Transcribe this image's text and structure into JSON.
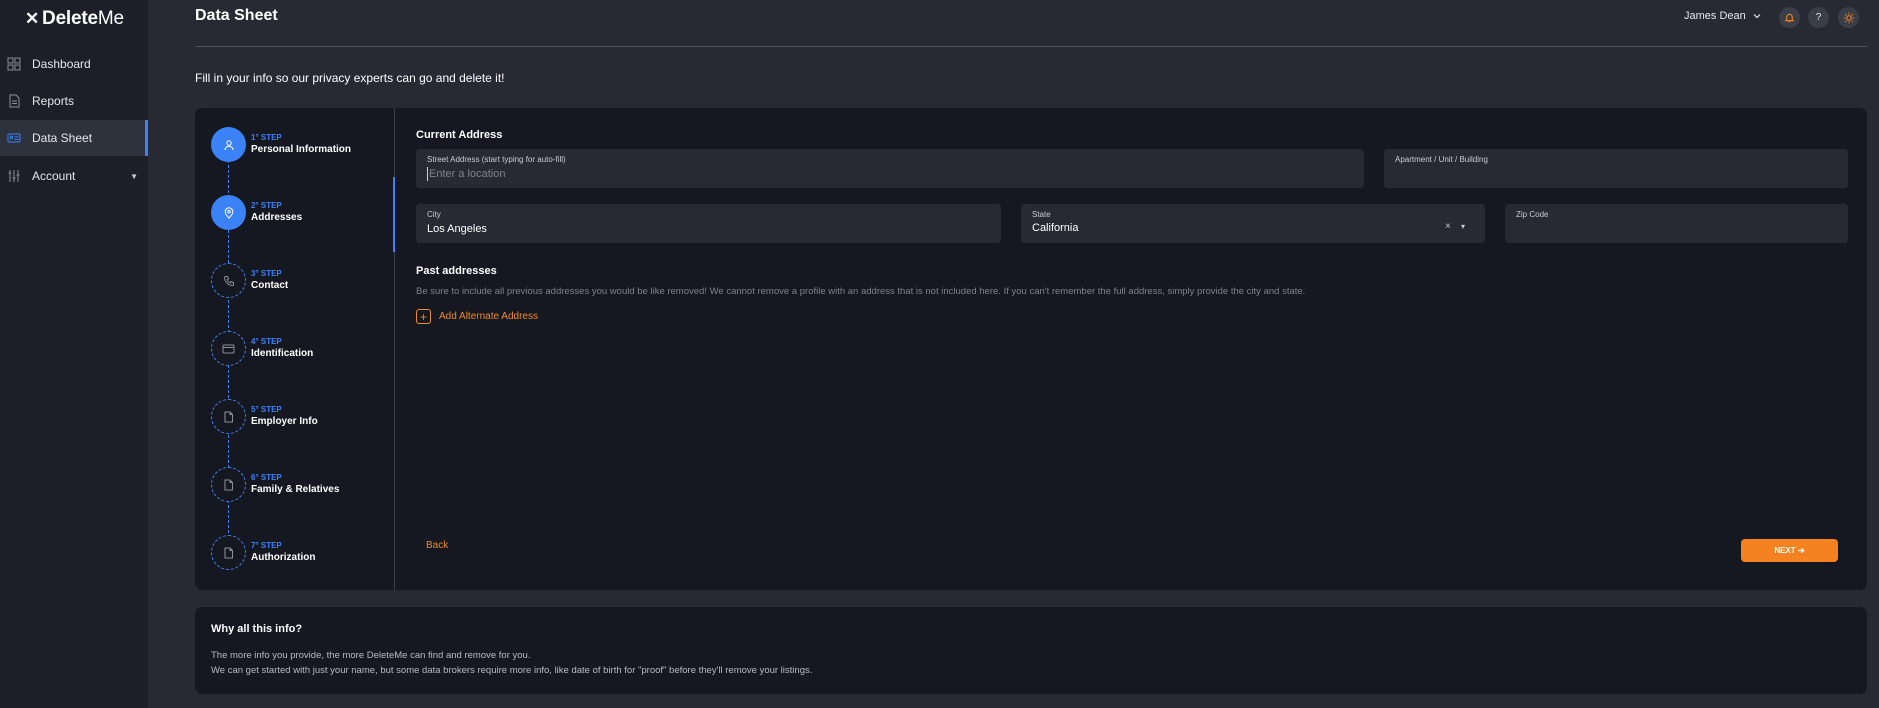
{
  "app": {
    "logo_mark": "✕",
    "logo_bold": "Delete",
    "logo_light": "Me"
  },
  "sidebar": {
    "items": [
      {
        "label": "Dashboard",
        "icon": "grid-icon"
      },
      {
        "label": "Reports",
        "icon": "document-icon"
      },
      {
        "label": "Data Sheet",
        "icon": "id-card-icon",
        "active": true
      },
      {
        "label": "Account",
        "icon": "sliders-icon",
        "has_caret": true
      }
    ]
  },
  "header": {
    "title": "Data Sheet",
    "user_name": "James Dean",
    "bell_icon": "bell-icon",
    "help_label": "?",
    "theme_icon": "sun-icon"
  },
  "intro": "Fill in your info so our privacy experts can go and delete it!",
  "steps": [
    {
      "num": "1° STEP",
      "title": "Personal Information",
      "icon": "person-icon",
      "state": "done"
    },
    {
      "num": "2° STEP",
      "title": "Addresses",
      "icon": "location-pin-icon",
      "state": "current"
    },
    {
      "num": "3° STEP",
      "title": "Contact",
      "icon": "phone-icon",
      "state": "todo"
    },
    {
      "num": "4° STEP",
      "title": "Identification",
      "icon": "id-card-icon",
      "state": "todo"
    },
    {
      "num": "5° STEP",
      "title": "Employer Info",
      "icon": "file-icon",
      "state": "todo"
    },
    {
      "num": "6° STEP",
      "title": "Family & Relatives",
      "icon": "file-icon",
      "state": "todo"
    },
    {
      "num": "7° STEP",
      "title": "Authorization",
      "icon": "file-icon",
      "state": "todo"
    }
  ],
  "form": {
    "current_address_title": "Current Address",
    "street": {
      "label": "Street Address (start typing for auto-fill)",
      "placeholder": "Enter a location",
      "value": ""
    },
    "apartment": {
      "label": "Apartment / Unit / Building",
      "value": ""
    },
    "city": {
      "label": "City",
      "value": "Los Angeles"
    },
    "state": {
      "label": "State",
      "value": "California",
      "clear": "×",
      "dropdown": "▾"
    },
    "zip": {
      "label": "Zip Code",
      "value": ""
    },
    "past_title": "Past addresses",
    "past_help": "Be sure to include all previous addresses you would be like removed! We cannot remove a profile with an address that is not included here. If you can't remember the full address, simply provide the city and state.",
    "add_alternate": "Add Alternate Address",
    "back": "Back",
    "next": "NEXT ➔"
  },
  "why": {
    "title": "Why all this info?",
    "line1": "The more info you provide, the more DeleteMe can find and remove for you.",
    "line2": "We can get started with just your name, but some data brokers require more info, like date of birth for \"proof\" before they'll remove your listings."
  },
  "colors": {
    "accent_blue": "#3b82f6",
    "accent_orange": "#f58220",
    "bg": "#272a33",
    "card": "#151821",
    "sidebar": "#1c1f27"
  }
}
